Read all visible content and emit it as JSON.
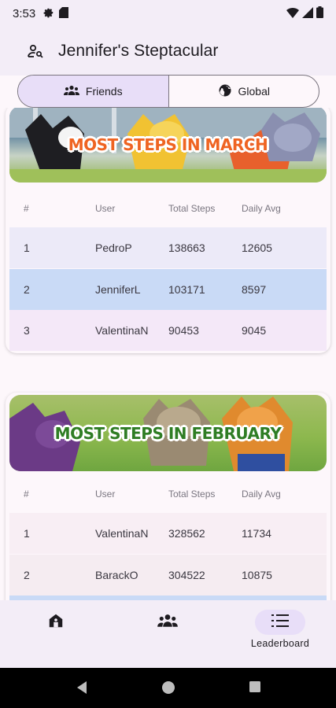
{
  "status_bar": {
    "time": "3:53",
    "icons": [
      "settings-icon",
      "sd-card-icon",
      "wifi-icon",
      "signal-icon",
      "battery-icon"
    ]
  },
  "app_bar": {
    "title": "Jennifer's Steptacular",
    "leading_icon": "person-search-icon"
  },
  "segmented": {
    "options": [
      {
        "label": "Friends",
        "icon": "group-icon",
        "selected": true
      },
      {
        "label": "Global",
        "icon": "globe-icon",
        "selected": false
      }
    ]
  },
  "leaderboards": [
    {
      "banner_title": "MOST STEPS IN MARCH",
      "columns": [
        "#",
        "User",
        "Total Steps",
        "Daily Avg"
      ],
      "rows": [
        {
          "rank": "1",
          "user": "PedroP",
          "total": "138663",
          "avg": "12605"
        },
        {
          "rank": "2",
          "user": "JenniferL",
          "total": "103171",
          "avg": "8597"
        },
        {
          "rank": "3",
          "user": "ValentinaN",
          "total": "90453",
          "avg": "9045"
        }
      ]
    },
    {
      "banner_title": "MOST STEPS IN FEBRUARY",
      "columns": [
        "#",
        "User",
        "Total Steps",
        "Daily Avg"
      ],
      "rows": [
        {
          "rank": "1",
          "user": "ValentinaN",
          "total": "328562",
          "avg": "11734"
        },
        {
          "rank": "2",
          "user": "BarackO",
          "total": "304522",
          "avg": "10875"
        }
      ]
    }
  ],
  "bottom_nav": {
    "items": [
      {
        "label": "",
        "icon": "home-icon",
        "active": false
      },
      {
        "label": "",
        "icon": "group-icon",
        "active": false
      },
      {
        "label": "Leaderboard",
        "icon": "leaderboard-list-icon",
        "active": true
      }
    ]
  },
  "colors": {
    "selected_bg": "#e8def8",
    "highlight_row": "#c9daf6",
    "surface": "#f3edf7"
  }
}
